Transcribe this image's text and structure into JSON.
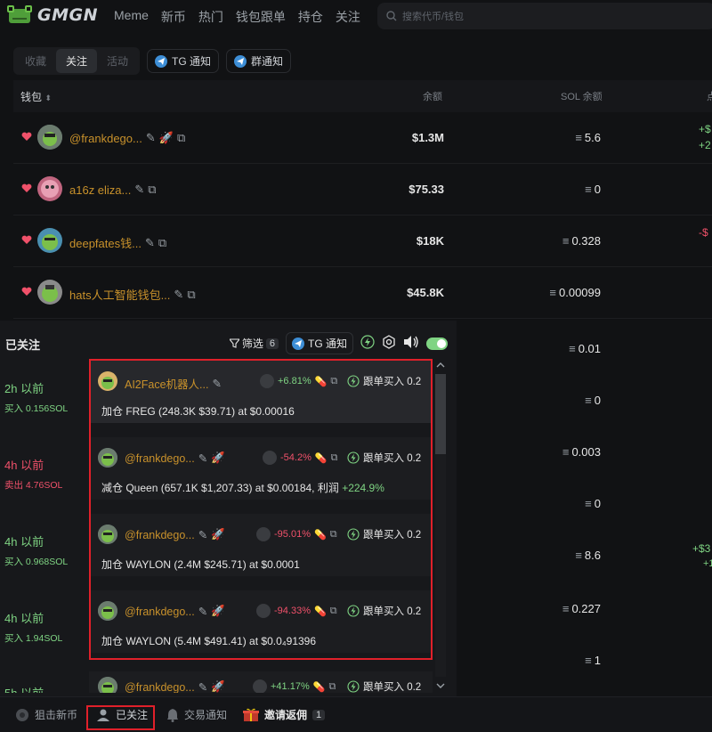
{
  "header": {
    "logo_text": "GMGN",
    "nav": [
      "Meme",
      "新币",
      "热门",
      "钱包跟单",
      "持仓",
      "关注"
    ],
    "search_placeholder": "搜索代币/钱包"
  },
  "filters": {
    "tabs": [
      "收藏",
      "关注",
      "活动"
    ],
    "active_tab": "关注",
    "tg_notify": "TG 通知",
    "group_notify": "群通知"
  },
  "table": {
    "headers": {
      "wallet": "钱包",
      "balance": "余额",
      "sol_balance": "SOL 余额"
    },
    "rows": [
      {
        "name": "@frankdego...",
        "balance": "$1.3M",
        "sol": "5.6",
        "pnl1": "+$",
        "pnl2": "+2"
      },
      {
        "name": "a16z eliza...",
        "balance": "$75.33",
        "sol": "0",
        "pnl1": "",
        "pnl2": ""
      },
      {
        "name": "deepfates钱...",
        "balance": "$18K",
        "sol": "0.328",
        "pnl1": "-$",
        "pnl2": ""
      },
      {
        "name": "hats人工智能钱包...",
        "balance": "$45.8K",
        "sol": "0.00099",
        "pnl1": "",
        "pnl2": ""
      }
    ],
    "right_column": [
      {
        "sol": "0.01",
        "pnl1": "",
        "pnl2": ""
      },
      {
        "sol": "0",
        "pnl1": "",
        "pnl2": ""
      },
      {
        "sol": "0.003",
        "pnl1": "",
        "pnl2": ""
      },
      {
        "sol": "0",
        "pnl1": "",
        "pnl2": ""
      },
      {
        "sol": "8.6",
        "pnl1": "+$3",
        "pnl2": "+1"
      },
      {
        "sol": "0.227",
        "pnl1": "",
        "pnl2": ""
      },
      {
        "sol": "1",
        "pnl1": "",
        "pnl2": ""
      }
    ],
    "sol_symbol": "≡"
  },
  "panel": {
    "title": "已关注",
    "filter_label": "筛选",
    "filter_count": "6",
    "tg_notify": "TG 通知",
    "feed": [
      {
        "time": "2h 以前",
        "action": "买入 0.156SOL",
        "color": "#7fd483"
      },
      {
        "time": "4h 以前",
        "action": "卖出 4.76SOL",
        "color": "#f0516a"
      },
      {
        "time": "4h 以前",
        "action": "买入 0.968SOL",
        "color": "#7fd483"
      },
      {
        "time": "4h 以前",
        "action": "买入 1.94SOL",
        "color": "#7fd483"
      },
      {
        "time": "5h 以前",
        "action": "",
        "color": "#7fd483"
      }
    ],
    "cards": [
      {
        "name": "AI2Face机器人...",
        "pct": "+6.81%",
        "pct_color": "#7fd483",
        "copy": "跟单买入 0.2",
        "text": "加仓 FREG (248.3K $39.71) at $0.00016",
        "profit": ""
      },
      {
        "name": "@frankdego...",
        "pct": "-54.2%",
        "pct_color": "#f0516a",
        "copy": "跟单买入 0.2",
        "text": "减仓 Queen (657.1K $1,207.33) at $0.00184, 利润",
        "profit": "+224.9%"
      },
      {
        "name": "@frankdego...",
        "pct": "-95.01%",
        "pct_color": "#f0516a",
        "copy": "跟单买入 0.2",
        "text": "加仓 WAYLON (2.4M $245.71) at $0.0001",
        "profit": ""
      },
      {
        "name": "@frankdego...",
        "pct": "-94.33%",
        "pct_color": "#f0516a",
        "copy": "跟单买入 0.2",
        "text": "加仓 WAYLON (5.4M $491.41) at $0.0₄91396",
        "profit": ""
      },
      {
        "name": "@frankdego...",
        "pct": "+41.17%",
        "pct_color": "#7fd483",
        "copy": "跟单买入 0.2",
        "text": "",
        "profit": ""
      }
    ]
  },
  "bottom": {
    "snipe": "狙击新币",
    "followed": "已关注",
    "trade_notify": "交易通知",
    "invite": "邀请返佣",
    "invite_count": "1"
  }
}
